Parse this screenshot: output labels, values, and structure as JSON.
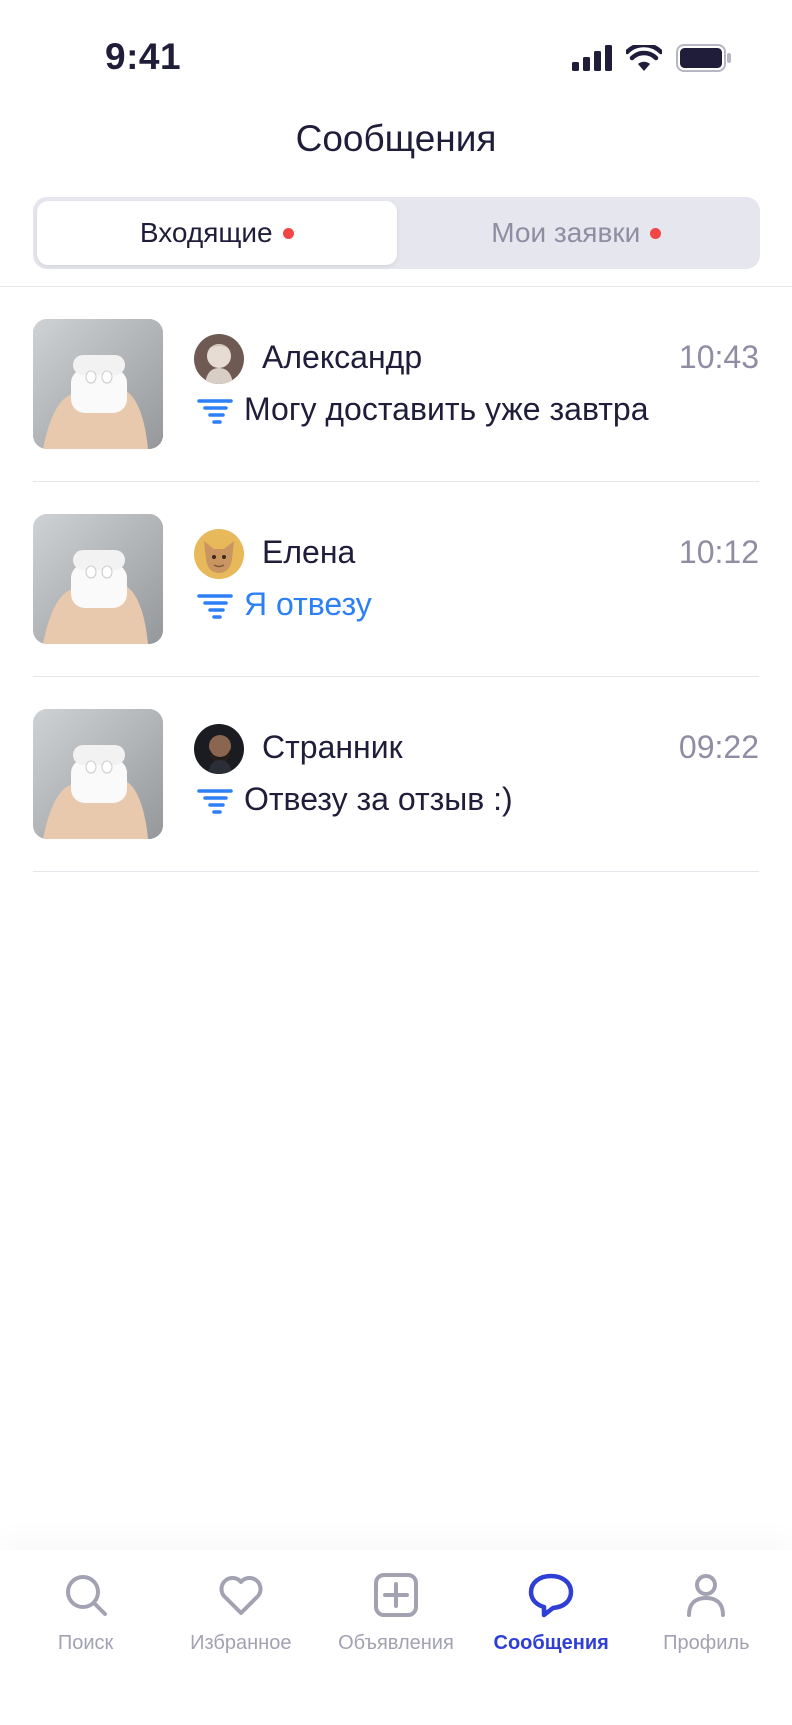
{
  "status_bar": {
    "time": "9:41"
  },
  "header": {
    "title": "Сообщения"
  },
  "segments": [
    {
      "label": "Входящие",
      "active": true,
      "has_dot": true
    },
    {
      "label": "Мои заявки",
      "active": false,
      "has_dot": true
    }
  ],
  "conversations": [
    {
      "sender": "Александр",
      "time": "10:43",
      "message": "Могу доставить уже завтра",
      "highlighted": false
    },
    {
      "sender": "Елена",
      "time": "10:12",
      "message": "Я отвезу",
      "highlighted": true
    },
    {
      "sender": "Странник",
      "time": "09:22",
      "message": "Отвезу за отзыв :)",
      "highlighted": false
    }
  ],
  "tab_bar": [
    {
      "label": "Поиск",
      "icon": "search-icon",
      "active": false
    },
    {
      "label": "Избранное",
      "icon": "heart-icon",
      "active": false
    },
    {
      "label": "Объявления",
      "icon": "plus-square-icon",
      "active": false
    },
    {
      "label": "Сообщения",
      "icon": "chat-bubble-icon",
      "active": true
    },
    {
      "label": "Профиль",
      "icon": "person-icon",
      "active": false
    }
  ],
  "colors": {
    "accent": "#2f3fd6",
    "highlight_text": "#2d7ff5",
    "notification_dot": "#f24545",
    "muted": "#8f8da3"
  }
}
